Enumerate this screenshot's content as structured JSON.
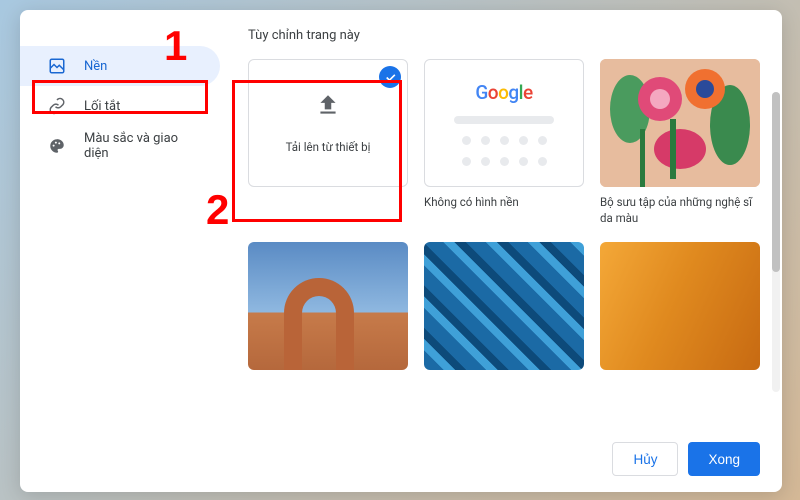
{
  "title": "Tùy chỉnh trang này",
  "sidebar": {
    "items": [
      {
        "label": "Nền",
        "icon": "image-frame-icon",
        "active": true
      },
      {
        "label": "Lối tắt",
        "icon": "link-icon",
        "active": false
      },
      {
        "label": "Màu sắc và giao diện",
        "icon": "palette-icon",
        "active": false
      }
    ]
  },
  "tiles": {
    "upload": {
      "label": "Tải lên từ thiết bị",
      "selected": true
    },
    "none": {
      "label": "Không có hình nền"
    },
    "artists": {
      "label": "Bộ sưu tập của những nghệ sĩ da màu"
    }
  },
  "buttons": {
    "cancel": "Hủy",
    "done": "Xong"
  },
  "annotations": {
    "one": "1",
    "two": "2"
  }
}
